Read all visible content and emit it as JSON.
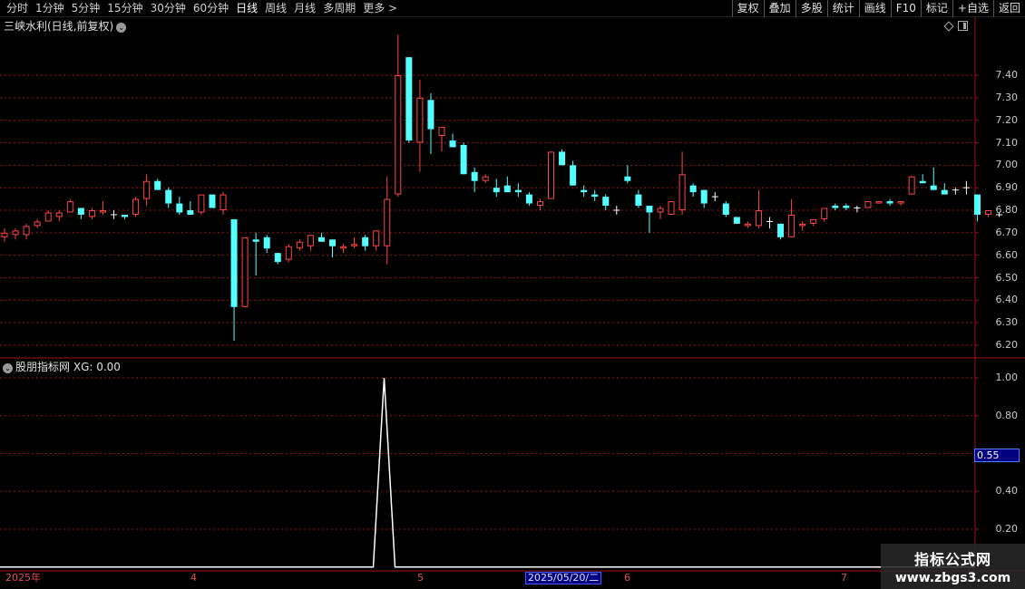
{
  "toolbar": {
    "timeframes": [
      {
        "label": "分时",
        "active": false
      },
      {
        "label": "1分钟",
        "active": false
      },
      {
        "label": "5分钟",
        "active": false
      },
      {
        "label": "15分钟",
        "active": false
      },
      {
        "label": "30分钟",
        "active": false
      },
      {
        "label": "60分钟",
        "active": false
      },
      {
        "label": "日线",
        "active": true
      },
      {
        "label": "周线",
        "active": false
      },
      {
        "label": "月线",
        "active": false
      },
      {
        "label": "多周期",
        "active": false
      },
      {
        "label": "更多 >",
        "active": false
      }
    ],
    "tools": [
      "复权",
      "叠加",
      "多股",
      "统计",
      "画线",
      "F10",
      "标记",
      "+自选",
      "返回"
    ]
  },
  "main_pane": {
    "title": "三峡水利(日线,前复权)",
    "title_icon": "chevron-down-icon",
    "y_ticks": [
      "7.40",
      "7.30",
      "7.20",
      "7.10",
      "7.00",
      "6.90",
      "6.80",
      "6.70",
      "6.60",
      "6.50",
      "6.40",
      "6.30",
      "6.20"
    ]
  },
  "indicator_pane": {
    "title": "股朋指标网",
    "title_icon": "chevron-down-icon",
    "xg_label": "XG: 0.00",
    "y_ticks": [
      "1.00",
      "0.80",
      "0.40",
      "0.20"
    ],
    "cursor_value": "0.55"
  },
  "x_axis": {
    "labels": [
      "2025年",
      "4",
      "5",
      "6",
      "7"
    ],
    "cursor_date": "2025/05/20/二"
  },
  "watermark": {
    "line1": "指标公式网",
    "line2": "www.zbgs3.com"
  },
  "colors": {
    "up": "#ff4444",
    "down": "#54ffff",
    "doji": "#ffffff",
    "grid": "#a01010",
    "indicator_line": "#ffffff",
    "cursor_bg": "#000080"
  },
  "chart_data": {
    "type": "candlestick",
    "title": "三峡水利(日线,前复权)",
    "ylim": [
      6.15,
      7.55
    ],
    "x_labels": [
      "2025年",
      "4",
      "5",
      "6",
      "7"
    ],
    "ohlc": [
      [
        6.68,
        6.72,
        6.66,
        6.7
      ],
      [
        6.69,
        6.72,
        6.67,
        6.71
      ],
      [
        6.69,
        6.74,
        6.67,
        6.73
      ],
      [
        6.73,
        6.76,
        6.72,
        6.75
      ],
      [
        6.75,
        6.8,
        6.75,
        6.79
      ],
      [
        6.77,
        6.8,
        6.75,
        6.79
      ],
      [
        6.79,
        6.85,
        6.79,
        6.84
      ],
      [
        6.81,
        6.81,
        6.76,
        6.78
      ],
      [
        6.77,
        6.81,
        6.76,
        6.8
      ],
      [
        6.79,
        6.84,
        6.78,
        6.8
      ],
      [
        6.78,
        6.8,
        6.76,
        6.78
      ],
      [
        6.78,
        6.78,
        6.76,
        6.77
      ],
      [
        6.78,
        6.86,
        6.77,
        6.85
      ],
      [
        6.85,
        6.96,
        6.82,
        6.93
      ],
      [
        6.93,
        6.94,
        6.89,
        6.89
      ],
      [
        6.89,
        6.9,
        6.81,
        6.83
      ],
      [
        6.83,
        6.86,
        6.78,
        6.79
      ],
      [
        6.8,
        6.84,
        6.78,
        6.78
      ],
      [
        6.79,
        6.87,
        6.78,
        6.87
      ],
      [
        6.87,
        6.87,
        6.81,
        6.81
      ],
      [
        6.8,
        6.88,
        6.78,
        6.87
      ],
      [
        6.76,
        6.76,
        6.22,
        6.37
      ],
      [
        6.37,
        6.68,
        6.37,
        6.68
      ],
      [
        6.67,
        6.7,
        6.51,
        6.66
      ],
      [
        6.68,
        6.69,
        6.61,
        6.63
      ],
      [
        6.61,
        6.61,
        6.56,
        6.57
      ],
      [
        6.58,
        6.65,
        6.57,
        6.64
      ],
      [
        6.63,
        6.67,
        6.62,
        6.66
      ],
      [
        6.64,
        6.69,
        6.62,
        6.69
      ],
      [
        6.68,
        6.7,
        6.66,
        6.66
      ],
      [
        6.67,
        6.67,
        6.59,
        6.64
      ],
      [
        6.63,
        6.65,
        6.61,
        6.64
      ],
      [
        6.64,
        6.68,
        6.63,
        6.65
      ],
      [
        6.68,
        6.69,
        6.62,
        6.64
      ],
      [
        6.64,
        6.71,
        6.62,
        6.71
      ],
      [
        6.64,
        6.95,
        6.56,
        6.85
      ],
      [
        6.87,
        7.58,
        6.86,
        7.4
      ],
      [
        7.48,
        7.48,
        7.1,
        7.11
      ],
      [
        7.1,
        7.38,
        6.97,
        7.3
      ],
      [
        7.29,
        7.32,
        7.05,
        7.16
      ],
      [
        7.13,
        7.17,
        7.06,
        7.17
      ],
      [
        7.11,
        7.14,
        7.08,
        7.08
      ],
      [
        7.09,
        7.1,
        6.96,
        6.96
      ],
      [
        6.97,
        6.99,
        6.88,
        6.93
      ],
      [
        6.93,
        6.96,
        6.92,
        6.95
      ],
      [
        6.9,
        6.94,
        6.86,
        6.88
      ],
      [
        6.91,
        6.95,
        6.89,
        6.88
      ],
      [
        6.89,
        6.92,
        6.86,
        6.88
      ],
      [
        6.87,
        6.88,
        6.82,
        6.83
      ],
      [
        6.82,
        6.85,
        6.8,
        6.84
      ],
      [
        6.85,
        7.06,
        6.85,
        7.06
      ],
      [
        7.06,
        7.07,
        7.0,
        7.0
      ],
      [
        7.0,
        7.02,
        6.91,
        6.91
      ],
      [
        6.89,
        6.91,
        6.86,
        6.88
      ],
      [
        6.87,
        6.89,
        6.84,
        6.86
      ],
      [
        6.86,
        6.87,
        6.8,
        6.82
      ],
      [
        6.8,
        6.82,
        6.78,
        6.8
      ],
      [
        6.95,
        7.0,
        6.92,
        6.93
      ],
      [
        6.87,
        6.89,
        6.81,
        6.82
      ],
      [
        6.82,
        6.82,
        6.7,
        6.79
      ],
      [
        6.79,
        6.82,
        6.76,
        6.81
      ],
      [
        6.78,
        6.84,
        6.78,
        6.84
      ],
      [
        6.8,
        7.06,
        6.78,
        6.96
      ],
      [
        6.91,
        6.92,
        6.86,
        6.88
      ],
      [
        6.89,
        6.89,
        6.81,
        6.83
      ],
      [
        6.86,
        6.88,
        6.84,
        6.86
      ],
      [
        6.83,
        6.84,
        6.77,
        6.78
      ],
      [
        6.77,
        6.77,
        6.74,
        6.74
      ],
      [
        6.73,
        6.75,
        6.72,
        6.74
      ],
      [
        6.73,
        6.89,
        6.72,
        6.8
      ],
      [
        6.75,
        6.77,
        6.72,
        6.75
      ],
      [
        6.74,
        6.74,
        6.67,
        6.68
      ],
      [
        6.68,
        6.85,
        6.68,
        6.78
      ],
      [
        6.73,
        6.75,
        6.71,
        6.74
      ],
      [
        6.74,
        6.76,
        6.73,
        6.76
      ],
      [
        6.76,
        6.8,
        6.75,
        6.81
      ],
      [
        6.82,
        6.83,
        6.8,
        6.81
      ],
      [
        6.82,
        6.83,
        6.8,
        6.81
      ],
      [
        6.81,
        6.82,
        6.79,
        6.81
      ],
      [
        6.81,
        6.84,
        6.81,
        6.84
      ],
      [
        6.83,
        6.84,
        6.83,
        6.84
      ],
      [
        6.84,
        6.85,
        6.82,
        6.83
      ],
      [
        6.83,
        6.84,
        6.82,
        6.84
      ],
      [
        6.87,
        6.95,
        6.87,
        6.95
      ],
      [
        6.93,
        6.96,
        6.92,
        6.92
      ],
      [
        6.91,
        6.99,
        6.89,
        6.89
      ],
      [
        6.89,
        6.92,
        6.87,
        6.87
      ],
      [
        6.89,
        6.9,
        6.87,
        6.89
      ],
      [
        6.9,
        6.93,
        6.87,
        6.9
      ],
      [
        6.87,
        6.87,
        6.75,
        6.78
      ],
      [
        6.78,
        6.8,
        6.77,
        6.8
      ],
      [
        6.78,
        6.79,
        6.77,
        6.78
      ]
    ],
    "indicator": {
      "name": "XG",
      "series": "spike to 1.00 on a single bar (near 2025-05 start), 0 elsewhere",
      "ylim": [
        0,
        1.06
      ],
      "spike_index": 36,
      "spike_value": 1.0
    }
  }
}
